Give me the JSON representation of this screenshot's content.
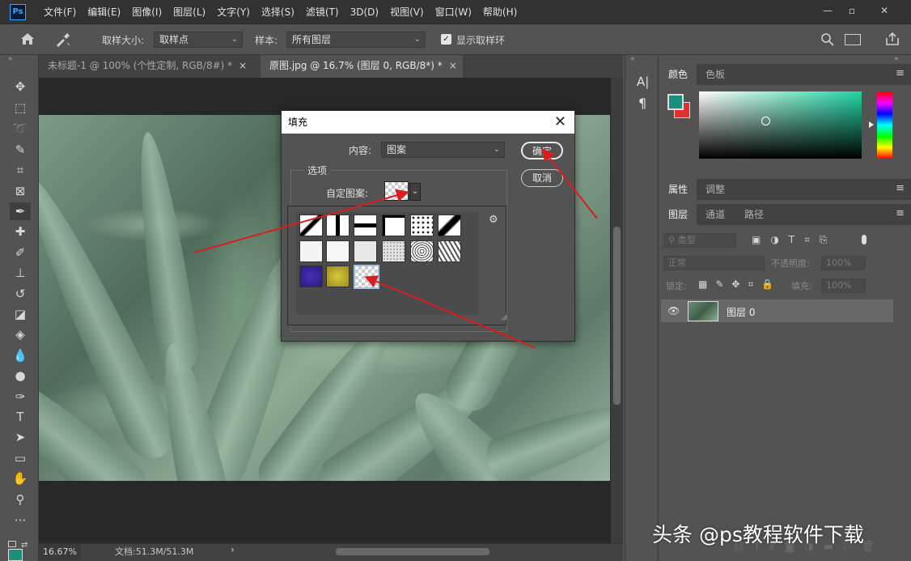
{
  "app": {
    "logo": "Ps",
    "menu": [
      "文件(F)",
      "编辑(E)",
      "图像(I)",
      "图层(L)",
      "文字(Y)",
      "选择(S)",
      "滤镜(T)",
      "3D(D)",
      "视图(V)",
      "窗口(W)",
      "帮助(H)"
    ],
    "window_controls": {
      "minimize": "—",
      "restore": "▫",
      "close": "✕"
    }
  },
  "options_bar": {
    "sample_size_label": "取样大小:",
    "sample_size_value": "取样点",
    "sample_label": "样本:",
    "sample_value": "所有图层",
    "show_ring_label": "显示取样环",
    "show_ring_checked": "✓"
  },
  "tabs": [
    {
      "label": "未标题-1 @ 100% (个性定制, RGB/8#) *",
      "close": "×"
    },
    {
      "label": "原图.jpg @ 16.7% (图层 0, RGB/8*) *",
      "close": "×"
    }
  ],
  "status": {
    "zoom": "16.67%",
    "doc_info": "文档:51.3M/51.3M",
    "arrow": "›"
  },
  "dialog": {
    "title": "填充",
    "close": "✕",
    "content_label": "内容:",
    "content_value": "图案",
    "options_group": "选项",
    "custom_pattern_label": "自定图案:",
    "ok_label": "确定",
    "cancel_label": "取消"
  },
  "right_panel": {
    "color_tabs": [
      "颜色",
      "色板"
    ],
    "props_tabs": [
      "属性",
      "调整"
    ],
    "layers_tabs": [
      "图层",
      "通道",
      "路径"
    ],
    "filter_kind": "类型",
    "blend_mode": "正常",
    "opacity_label": "不透明度:",
    "opacity_value": "100%",
    "lock_label": "锁定:",
    "fill_label": "填充:",
    "fill_value": "100%",
    "layer_name": "图层 0",
    "foreground_color": "#1a8f7a",
    "background_color": "#e03030"
  },
  "mini_panel": {
    "char": "A|",
    "para": "¶"
  },
  "watermark": "头条 @ps教程软件下载",
  "colors": {
    "arrow": "#d81e1e",
    "accent": "#1fd6a2"
  }
}
